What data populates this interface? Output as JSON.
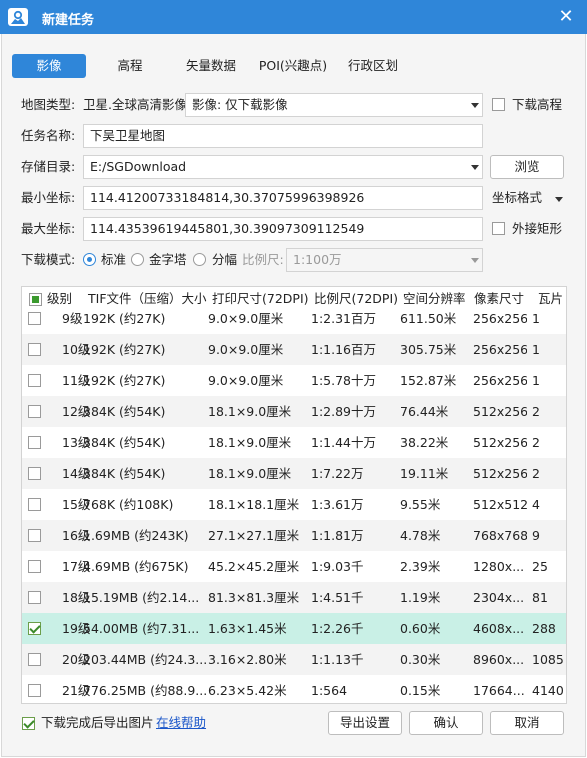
{
  "window": {
    "title": "新建任务"
  },
  "tabs": [
    "影像",
    "高程",
    "矢量数据",
    "POI(兴趣点)",
    "行政区划"
  ],
  "form": {
    "map_type_label": "地图类型:",
    "map_type_value": "卫星.全球高清影像",
    "image_mode_value": "影像: 仅下载影像",
    "download_elevation": "下载高程",
    "task_name_label": "任务名称:",
    "task_name_value": "下吴卫星地图",
    "storage_label": "存储目录:",
    "storage_value": "E:/SGDownload",
    "browse": "浏览",
    "min_coord_label": "最小坐标:",
    "min_coord_value": "114.41200733184814,30.37075996398926",
    "coord_format": "坐标格式",
    "max_coord_label": "最大坐标:",
    "max_coord_value": "114.43539619445801,30.39097309112549",
    "outer_rect": "外接矩形",
    "mode_label": "下载模式:",
    "mode_standard": "标准",
    "mode_pyramid": "金字塔",
    "mode_tile": "分幅",
    "scale_label": "比例尺:",
    "scale_value": "1:100万"
  },
  "table": {
    "headers": [
      "级别",
      "TIF文件（压缩）大小",
      "打印尺寸(72DPI)",
      "比例尺(72DPI)",
      "空间分辨率",
      "像素尺寸",
      "瓦片"
    ],
    "rows": [
      {
        "level": "9级",
        "size": "192K (约27K)",
        "print": "9.0×9.0厘米",
        "scale": "1:2.31百万",
        "res": "611.50米",
        "px": "256x256",
        "tiles": "1",
        "checked": false
      },
      {
        "level": "10级",
        "size": "192K (约27K)",
        "print": "9.0×9.0厘米",
        "scale": "1:1.16百万",
        "res": "305.75米",
        "px": "256x256",
        "tiles": "1",
        "checked": false
      },
      {
        "level": "11级",
        "size": "192K (约27K)",
        "print": "9.0×9.0厘米",
        "scale": "1:5.78十万",
        "res": "152.87米",
        "px": "256x256",
        "tiles": "1",
        "checked": false
      },
      {
        "level": "12级",
        "size": "384K (约54K)",
        "print": "18.1×9.0厘米",
        "scale": "1:2.89十万",
        "res": "76.44米",
        "px": "512x256",
        "tiles": "2",
        "checked": false
      },
      {
        "level": "13级",
        "size": "384K (约54K)",
        "print": "18.1×9.0厘米",
        "scale": "1:1.44十万",
        "res": "38.22米",
        "px": "512x256",
        "tiles": "2",
        "checked": false
      },
      {
        "level": "14级",
        "size": "384K (约54K)",
        "print": "18.1×9.0厘米",
        "scale": "1:7.22万",
        "res": "19.11米",
        "px": "512x256",
        "tiles": "2",
        "checked": false
      },
      {
        "level": "15级",
        "size": "768K (约108K)",
        "print": "18.1×18.1厘米",
        "scale": "1:3.61万",
        "res": "9.55米",
        "px": "512x512",
        "tiles": "4",
        "checked": false
      },
      {
        "level": "16级",
        "size": "1.69MB (约243K)",
        "print": "27.1×27.1厘米",
        "scale": "1:1.81万",
        "res": "4.78米",
        "px": "768x768",
        "tiles": "9",
        "checked": false
      },
      {
        "level": "17级",
        "size": "4.69MB (约675K)",
        "print": "45.2×45.2厘米",
        "scale": "1:9.03千",
        "res": "2.39米",
        "px": "1280x...",
        "tiles": "25",
        "checked": false
      },
      {
        "level": "18级",
        "size": "15.19MB (约2.14...",
        "print": "81.3×81.3厘米",
        "scale": "1:4.51千",
        "res": "1.19米",
        "px": "2304x...",
        "tiles": "81",
        "checked": false
      },
      {
        "level": "19级",
        "size": "54.00MB (约7.31...",
        "print": "1.63×1.45米",
        "scale": "1:2.26千",
        "res": "0.60米",
        "px": "4608x...",
        "tiles": "288",
        "checked": true
      },
      {
        "level": "20级",
        "size": "203.44MB (约24.3...",
        "print": "3.16×2.80米",
        "scale": "1:1.13千",
        "res": "0.30米",
        "px": "8960x...",
        "tiles": "1085",
        "checked": false
      },
      {
        "level": "21级",
        "size": "776.25MB (约88.9...",
        "print": "6.23×5.42米",
        "scale": "1:564",
        "res": "0.15米",
        "px": "17664...",
        "tiles": "4140",
        "checked": false
      }
    ]
  },
  "footer": {
    "export_after": "下载完成后导出图片",
    "online_help": "在线帮助",
    "export_settings": "导出设置",
    "ok": "确认",
    "cancel": "取消"
  },
  "colors": {
    "accent": "#2f86d9",
    "selected_row": "#c9f0e6",
    "link": "#1a56c9"
  }
}
